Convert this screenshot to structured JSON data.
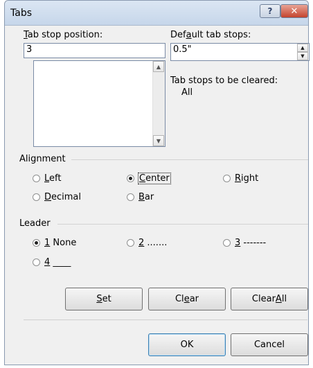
{
  "window": {
    "title": "Tabs",
    "help_glyph": "?",
    "close_glyph": "✕"
  },
  "tab_stop": {
    "label_pre": "",
    "label_ul": "T",
    "label_post": "ab stop position:",
    "value": "3"
  },
  "default_tab": {
    "label_pre": "Def",
    "label_ul": "a",
    "label_post": "ult tab stops:",
    "value": "0.5\""
  },
  "cleared": {
    "label": "Tab stops to be cleared:",
    "value": "All"
  },
  "alignment": {
    "title": "Alignment",
    "options": [
      {
        "pre": "",
        "ul": "L",
        "post": "eft",
        "selected": false
      },
      {
        "pre": "",
        "ul": "C",
        "post": "enter",
        "selected": true
      },
      {
        "pre": "",
        "ul": "R",
        "post": "ight",
        "selected": false
      },
      {
        "pre": "",
        "ul": "D",
        "post": "ecimal",
        "selected": false
      },
      {
        "pre": "",
        "ul": "B",
        "post": "ar",
        "selected": false
      }
    ]
  },
  "leader": {
    "title": "Leader",
    "options": [
      {
        "pre": "",
        "ul": "1",
        "post": " None",
        "selected": true
      },
      {
        "pre": "",
        "ul": "2",
        "post": " .......",
        "selected": false
      },
      {
        "pre": "",
        "ul": "3",
        "post": " -------",
        "selected": false
      },
      {
        "pre": "",
        "ul": "4",
        "post": " ____",
        "selected": false
      }
    ]
  },
  "buttons": {
    "set": {
      "pre": "",
      "ul": "S",
      "post": "et"
    },
    "clear": {
      "pre": "Cl",
      "ul": "e",
      "post": "ar"
    },
    "clear_all": {
      "pre": "Clear ",
      "ul": "A",
      "post": "ll"
    },
    "ok": "OK",
    "cancel": "Cancel"
  }
}
